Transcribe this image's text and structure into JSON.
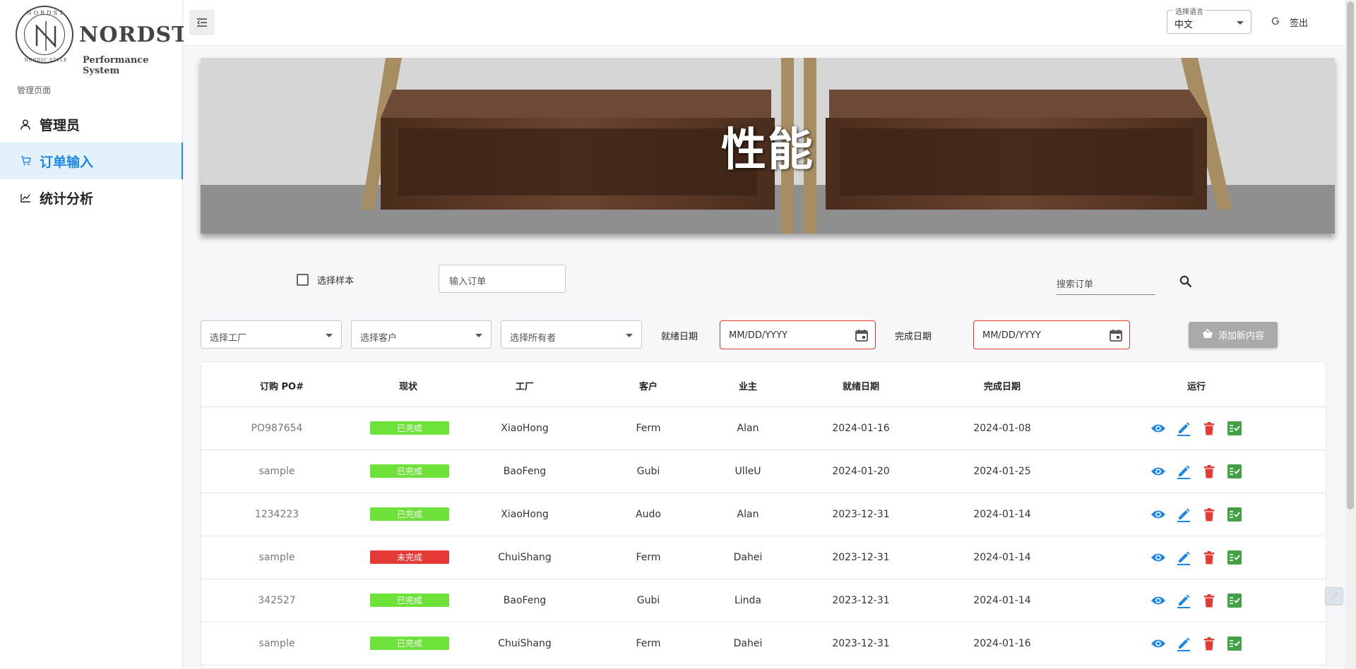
{
  "logo": {
    "name": "NORDST",
    "subtitle": "Performance System",
    "seal_text": "NORDST NORDIC STYLE"
  },
  "sidebar": {
    "section_label": "管理页面",
    "items": [
      {
        "label": "管理员",
        "icon": "user-icon"
      },
      {
        "label": "订单输入",
        "icon": "cart-icon",
        "active": true
      },
      {
        "label": "统计分析",
        "icon": "chart-icon"
      }
    ]
  },
  "topbar": {
    "language": {
      "legend": "选择语言",
      "value": "中文"
    },
    "logout_label": "签出"
  },
  "banner": {
    "title": "性能"
  },
  "filters": {
    "sample_checkbox_label": "选择样本",
    "order_input_placeholder": "输入订单",
    "search_placeholder": "搜索订单",
    "factory_select": "选择工厂",
    "customer_select": "选择客户",
    "owner_select": "选择所有者",
    "ready_date_label": "就绪日期",
    "ready_date_placeholder": "MM/DD/YYYY",
    "complete_date_label": "完成日期",
    "complete_date_placeholder": "MM/DD/YYYY",
    "add_button": "添加新内容"
  },
  "table": {
    "headers": [
      "订购 PO#",
      "现状",
      "工厂",
      "客户",
      "业主",
      "就绪日期",
      "完成日期",
      "运行"
    ],
    "rows": [
      {
        "po": "PO987654",
        "status": "已完成",
        "done": true,
        "factory": "XiaoHong",
        "customer": "Ferm",
        "owner": "Alan",
        "ready": "2024-01-16",
        "complete": "2024-01-08"
      },
      {
        "po": "sample",
        "status": "已完成",
        "done": true,
        "factory": "BaoFeng",
        "customer": "Gubi",
        "owner": "UlleU",
        "ready": "2024-01-20",
        "complete": "2024-01-25"
      },
      {
        "po": "1234223",
        "status": "已完成",
        "done": true,
        "factory": "XiaoHong",
        "customer": "Audo",
        "owner": "Alan",
        "ready": "2023-12-31",
        "complete": "2024-01-14"
      },
      {
        "po": "sample",
        "status": "未完成",
        "done": false,
        "factory": "ChuiShang",
        "customer": "Ferm",
        "owner": "Dahei",
        "ready": "2023-12-31",
        "complete": "2024-01-14"
      },
      {
        "po": "342527",
        "status": "已完成",
        "done": true,
        "factory": "BaoFeng",
        "customer": "Gubi",
        "owner": "Linda",
        "ready": "2023-12-31",
        "complete": "2024-01-14"
      },
      {
        "po": "sample",
        "status": "已完成",
        "done": true,
        "factory": "ChuiShang",
        "customer": "Ferm",
        "owner": "Dahei",
        "ready": "2023-12-31",
        "complete": "2024-01-16"
      }
    ]
  },
  "colors": {
    "accent": "#1e88e5",
    "done": "#6ee23a",
    "not_done": "#e53935",
    "view_icon": "#1e88e5",
    "delete_icon": "#e53935",
    "approve_icon": "#43a047"
  }
}
